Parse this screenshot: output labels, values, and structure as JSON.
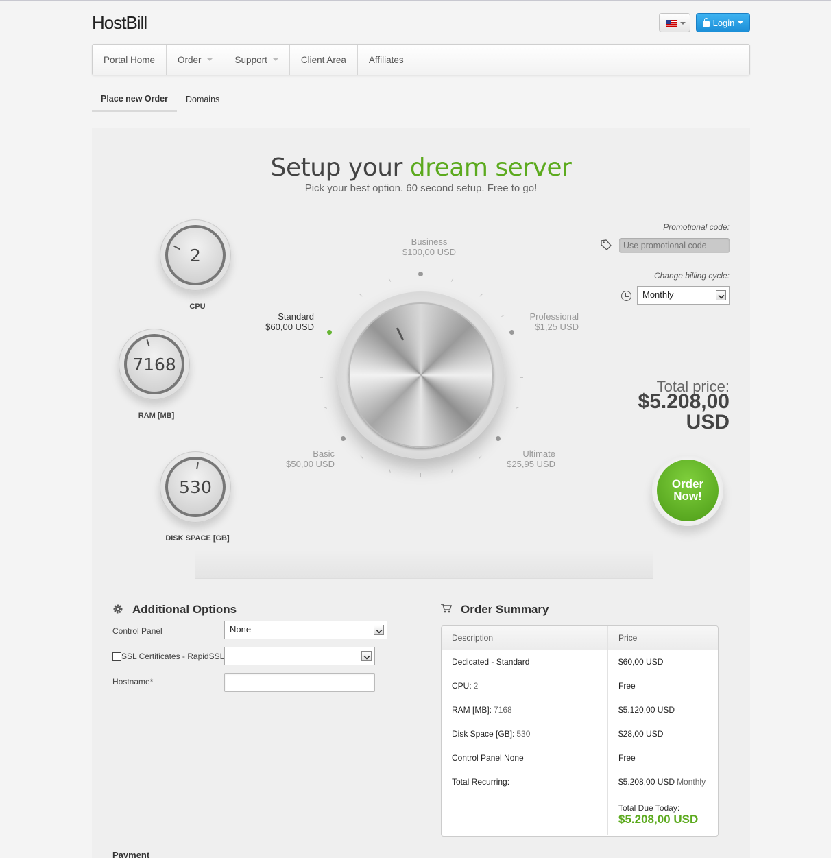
{
  "header": {
    "logo": "HostBill",
    "login_label": "Login",
    "lang_icon": "us-flag-icon"
  },
  "nav": {
    "items": [
      {
        "label": "Portal Home"
      },
      {
        "label": "Order"
      },
      {
        "label": "Support"
      },
      {
        "label": "Client Area"
      },
      {
        "label": "Affiliates"
      }
    ]
  },
  "subnav": {
    "items": [
      {
        "label": "Place new Order"
      },
      {
        "label": "Domains"
      }
    ]
  },
  "hero": {
    "title_plain": "Setup your ",
    "title_green": "dream server",
    "subtitle": "Pick your best option. 60 second setup. Free to go!"
  },
  "dials": {
    "cpu": {
      "value": "2",
      "label": "CPU"
    },
    "ram": {
      "value": "7168",
      "label": "RAM [MB]"
    },
    "disk": {
      "value": "530",
      "label": "DISK SPACE [GB]"
    }
  },
  "plans": {
    "business": {
      "name": "Business",
      "price": "$100,00 USD"
    },
    "standard": {
      "name": "Standard",
      "price": "$60,00 USD"
    },
    "professional": {
      "name": "Professional",
      "price": "$1,25 USD"
    },
    "basic": {
      "name": "Basic",
      "price": "$50,00 USD"
    },
    "ultimate": {
      "name": "Ultimate",
      "price": "$25,95 USD"
    }
  },
  "promo": {
    "label": "Promotional code:",
    "placeholder": "Use promotional code"
  },
  "billing": {
    "label": "Change billing cycle:",
    "value": "Monthly"
  },
  "total": {
    "label": "Total price:",
    "amount": "$5.208,00",
    "currency": "USD"
  },
  "order_button": "Order Now!",
  "additional_options": {
    "title": "Additional Options",
    "control_panel_label": "Control Panel",
    "control_panel_value": "None",
    "ssl_label": "SSL Certificates - RapidSSL",
    "ssl_value": "",
    "hostname_label": "Hostname*",
    "hostname_value": ""
  },
  "summary": {
    "title": "Order Summary",
    "col_description": "Description",
    "col_price": "Price",
    "rows": [
      {
        "desc": "Dedicated - Standard",
        "desc_extra": "",
        "price": "$60,00 USD",
        "price_extra": ""
      },
      {
        "desc": "CPU:",
        "desc_extra": "2",
        "price": "Free",
        "price_extra": ""
      },
      {
        "desc": "RAM [MB]:",
        "desc_extra": "7168",
        "price": "$5.120,00 USD",
        "price_extra": ""
      },
      {
        "desc": "Disk Space [GB]:",
        "desc_extra": "530",
        "price": "$28,00 USD",
        "price_extra": ""
      },
      {
        "desc": "Control Panel None",
        "desc_extra": "",
        "price": "Free",
        "price_extra": ""
      },
      {
        "desc": "Total Recurring:",
        "desc_extra": "",
        "price": "$5.208,00 USD",
        "price_extra": "Monthly"
      }
    ],
    "due_label": "Total Due Today:",
    "due_amount": "$5.208,00 USD",
    "due_color": "#5caa1e"
  },
  "payment_label": "Payment"
}
